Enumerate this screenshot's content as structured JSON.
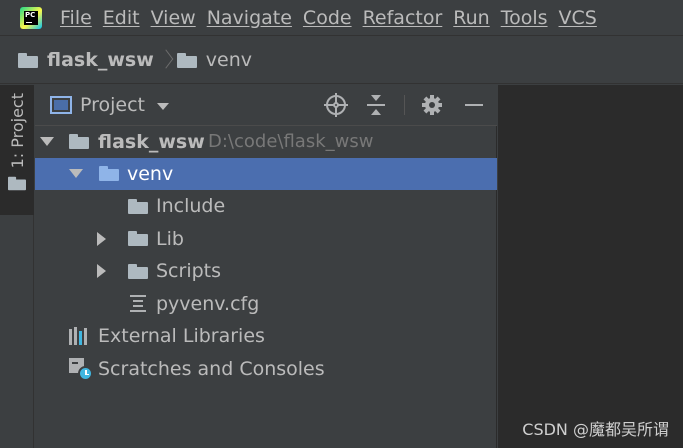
{
  "menubar": {
    "app_icon": "pycharm-logo",
    "app_icon_text": "PC",
    "items": [
      "File",
      "Edit",
      "View",
      "Navigate",
      "Code",
      "Refactor",
      "Run",
      "Tools",
      "VCS"
    ]
  },
  "breadcrumb": {
    "items": [
      {
        "label": "flask_wsw",
        "icon": "folder-icon"
      },
      {
        "label": "venv",
        "icon": "folder-icon"
      }
    ]
  },
  "tool_stripe": {
    "project_tab_label": "1: Project"
  },
  "project_panel": {
    "title": "Project",
    "header_icons": [
      "target-icon",
      "collapse-all-icon",
      "gear-icon",
      "minimize-icon"
    ],
    "tree": {
      "root": {
        "label": "flask_wsw",
        "path": "D:\\code\\flask_wsw",
        "expanded": true
      },
      "venv": {
        "label": "venv",
        "expanded": true,
        "selected": true
      },
      "include": {
        "label": "Include"
      },
      "lib": {
        "label": "Lib",
        "expanded": false
      },
      "scripts": {
        "label": "Scripts",
        "expanded": false
      },
      "pyvenv": {
        "label": "pyvenv.cfg"
      },
      "external_libraries": {
        "label": "External Libraries"
      },
      "scratches": {
        "label": "Scratches and Consoles"
      }
    }
  },
  "watermark": "CSDN @魔都吴所谓",
  "colors": {
    "panel_bg": "#3c3f41",
    "editor_bg": "#2b2b2b",
    "selection": "#4b6eaf",
    "text": "#bbbbbb",
    "path_text": "#787878",
    "folder": "#aeb9c0",
    "folder_selected": "#8fb4e8"
  }
}
